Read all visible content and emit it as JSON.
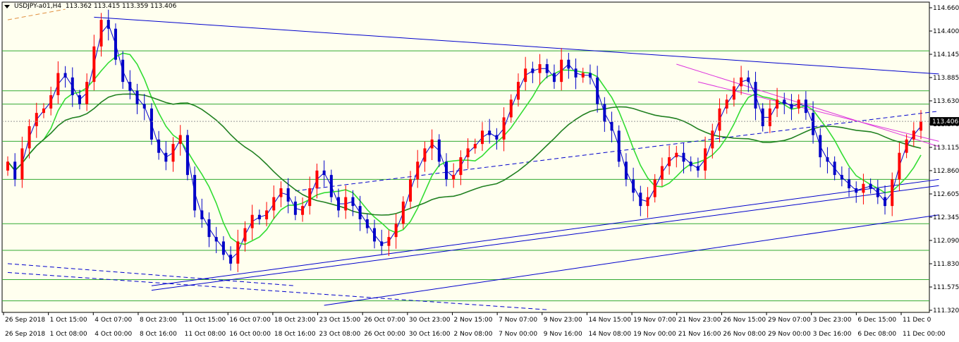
{
  "symbol": {
    "name": "USDJPY-a01,H4",
    "open": "113.362",
    "high": "113.415",
    "low": "113.359",
    "close": "113.406"
  },
  "price_scale": [
    "114.660",
    "114.400",
    "114.145",
    "113.885",
    "113.630",
    "113.370",
    "113.115",
    "112.860",
    "112.605",
    "112.345",
    "112.090",
    "111.830",
    "111.575",
    "111.320"
  ],
  "current_price": "113.406",
  "time_axis_top": [
    "26 Sep 2018",
    "1 Oct 15:00",
    "4 Oct 07:00",
    "8 Oct 23:00",
    "11 Oct 15:00",
    "16 Oct 07:00",
    "18 Oct 23:00",
    "23 Oct 15:00",
    "26 Oct 07:00",
    "30 Oct 23:00",
    "2 Nov 15:00",
    "7 Nov 07:00",
    "9 Nov 23:00",
    "14 Nov 15:00",
    "19 Nov 07:00",
    "21 Nov 23:00",
    "26 Nov 15:00",
    "29 Nov 07:00",
    "3 Dec 23:00",
    "6 Dec 15:00",
    "11 Dec 0"
  ],
  "time_axis_bottom": [
    "26 Sep 2018",
    "1 Oct 08:00",
    "4 Oct 00:00",
    "8 Oct 16:00",
    "11 Oct 08:00",
    "16 Oct 00:00",
    "18 Oct 16:00",
    "23 Oct 08:00",
    "26 Oct 00:00",
    "30 Oct 16:00",
    "2 Nov 08:00",
    "7 Nov 00:00",
    "9 Nov 16:00",
    "14 Nov 08:00",
    "19 Nov 00:00",
    "21 Nov 16:00",
    "26 Nov 08:00",
    "29 Nov 00:00",
    "3 Dec 16:00",
    "6 Dec 08:00",
    "11 Dec 00:00"
  ],
  "colors": {
    "background": "#ffffef",
    "bull": "#ff0000",
    "bear": "#0000c8",
    "ma_fast": "#0000cc",
    "ma_mid": "#33dd33",
    "ma_slow": "#208020",
    "trend": "#0000cc",
    "magenta": "#dd33dd",
    "hline": "#33aa33"
  },
  "chart_data": {
    "type": "candlestick",
    "y_range": [
      111.25,
      114.75
    ],
    "horizontal_levels": [
      114.2,
      113.75,
      113.6,
      113.18,
      112.75,
      112.25,
      111.95,
      111.62,
      111.38
    ],
    "closes": [
      112.95,
      112.75,
      113.1,
      113.35,
      113.5,
      113.55,
      113.7,
      113.95,
      113.9,
      113.7,
      113.6,
      113.85,
      114.25,
      114.55,
      114.45,
      114.1,
      113.85,
      113.75,
      113.6,
      113.55,
      113.2,
      113.05,
      112.95,
      113.15,
      113.25,
      112.8,
      112.4,
      112.3,
      112.1,
      112.05,
      111.9,
      111.8,
      112.05,
      112.2,
      112.35,
      112.3,
      112.4,
      112.55,
      112.65,
      112.5,
      112.35,
      112.45,
      112.65,
      112.85,
      112.8,
      112.55,
      112.4,
      112.55,
      112.45,
      112.3,
      112.2,
      112.05,
      112.0,
      112.1,
      112.25,
      112.5,
      112.75,
      112.95,
      113.1,
      113.2,
      112.95,
      112.75,
      112.8,
      113.0,
      113.1,
      113.15,
      113.3,
      113.25,
      113.2,
      113.45,
      113.65,
      113.85,
      114.0,
      113.95,
      114.05,
      113.95,
      113.85,
      114.1,
      114.0,
      113.9,
      113.95,
      113.9,
      113.6,
      113.4,
      113.3,
      112.95,
      112.75,
      112.6,
      112.45,
      112.55,
      112.75,
      112.9,
      113.0,
      113.05,
      112.95,
      112.9,
      112.85,
      113.1,
      113.3,
      113.55,
      113.65,
      113.8,
      113.9,
      113.85,
      113.55,
      113.35,
      113.55,
      113.65,
      113.6,
      113.55,
      113.65,
      113.5,
      113.25,
      113.0,
      112.95,
      112.8,
      112.75,
      112.65,
      112.6,
      112.7,
      112.65,
      112.55,
      112.45,
      112.75,
      113.05,
      113.2,
      113.3,
      113.4
    ]
  }
}
